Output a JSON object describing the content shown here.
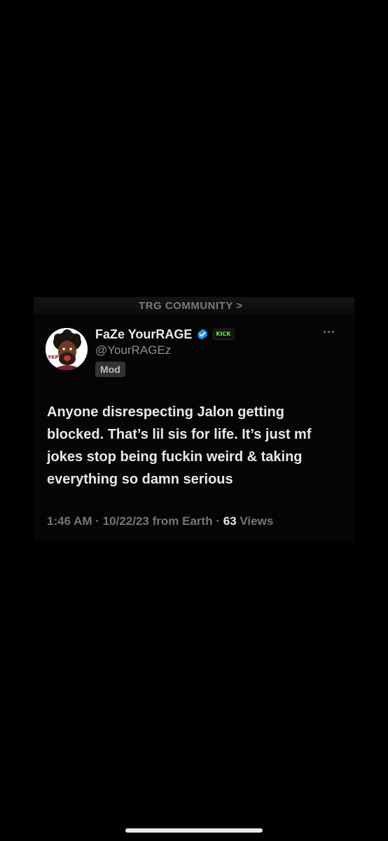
{
  "community_strip": {
    "text": "TRG COMMUNITY >"
  },
  "post": {
    "author": {
      "display_name": "FaZe YourRAGE",
      "handle": "@YourRAGEz",
      "role_badge": "Mod",
      "platform_badge": "KICK",
      "verified_color": "#1d9bf0",
      "avatar_icon": "cartoon-portrait-avatar"
    },
    "text": "Anyone disrespecting Jalon getting blocked. That’s lil sis for life. It’s just mf jokes stop being fuckin weird & taking everything so damn serious",
    "meta": {
      "time": "1:46 AM",
      "separator": "·",
      "date": "10/22/23",
      "location": "from Earth",
      "views_count": "63",
      "views_label": "Views"
    }
  },
  "colors": {
    "background": "#000000",
    "primary_text": "#e7e9ea",
    "secondary_text": "#71767b",
    "accent": "#1d9bf0",
    "kick_green": "#53fc18"
  }
}
